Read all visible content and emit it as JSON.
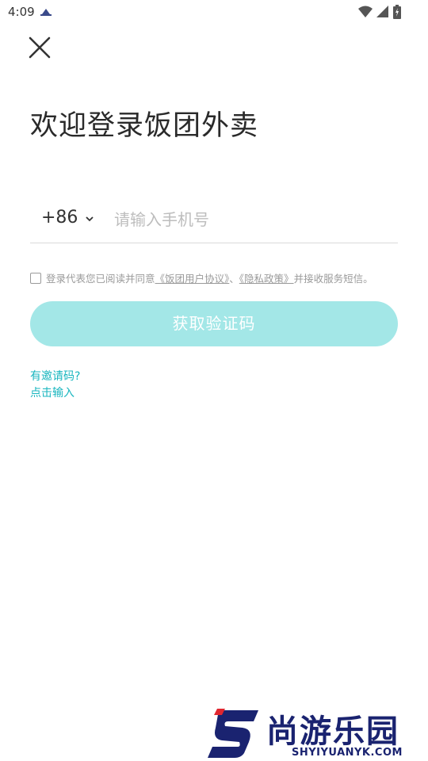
{
  "status_bar": {
    "time": "4:09"
  },
  "page": {
    "title": "欢迎登录饭团外卖",
    "country_code": "+86",
    "phone_placeholder": "请输入手机号",
    "agreement": {
      "prefix": "登录代表您已阅读并同意",
      "user_agreement": "《饭团用户协议》",
      "separator": "、",
      "privacy_policy": "《隐私政策》",
      "suffix": "并接收服务短信。"
    },
    "get_code_button": "获取验证码",
    "invite_question": "有邀请码?",
    "invite_link": "点击输入"
  },
  "watermark": {
    "text": "尚游乐园",
    "url_text": "SHYIYUANYK.COM"
  },
  "colors": {
    "accent": "#19b6bf",
    "button_bg": "#a3e7e7",
    "watermark": "#1a2370"
  }
}
